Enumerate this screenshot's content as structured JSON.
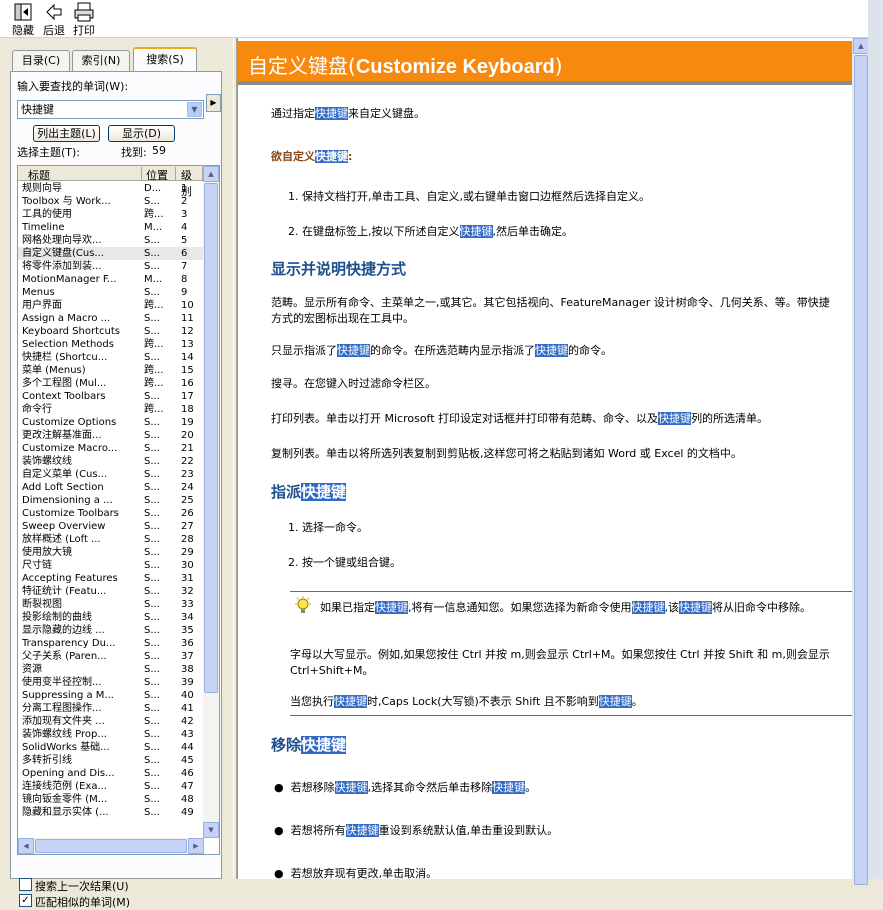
{
  "toolbar": {
    "hide": "隐藏",
    "back": "后退",
    "print": "打印"
  },
  "tabs": {
    "contents": "目录(C)",
    "index": "索引(N)",
    "search": "搜索(S)"
  },
  "search": {
    "prompt": "输入要查找的单词(W):",
    "value": "快捷键",
    "list_topics": "列出主题(L)",
    "display": "显示(D)",
    "select_topic": "选择主题(T):",
    "found_label": "找到:",
    "found_count": "59"
  },
  "columns": {
    "title": "标题",
    "location": "位置",
    "rank": "级别"
  },
  "results": [
    [
      "规则向导",
      "D...",
      "1"
    ],
    [
      "Toolbox 与 Work...",
      "S...",
      "2"
    ],
    [
      "工具的使用",
      "跨...",
      "3"
    ],
    [
      "Timeline",
      "M...",
      "4"
    ],
    [
      "网格处理向导欢...",
      "S...",
      "5"
    ],
    [
      "自定义键盘(Cus...",
      "S...",
      "6"
    ],
    [
      "将零件添加到装...",
      "S...",
      "7"
    ],
    [
      "MotionManager F...",
      "M...",
      "8"
    ],
    [
      "Menus",
      "S...",
      "9"
    ],
    [
      "用户界面",
      "跨...",
      "10"
    ],
    [
      "Assign a Macro ...",
      "S...",
      "11"
    ],
    [
      "Keyboard Shortcuts",
      "S...",
      "12"
    ],
    [
      "Selection Methods",
      "跨...",
      "13"
    ],
    [
      "快捷栏 (Shortcu...",
      "S...",
      "14"
    ],
    [
      "菜单 (Menus)",
      "跨...",
      "15"
    ],
    [
      "多个工程图 (Mul...",
      "跨...",
      "16"
    ],
    [
      "Context Toolbars",
      "S...",
      "17"
    ],
    [
      "命令行",
      "跨...",
      "18"
    ],
    [
      "Customize Options",
      "S...",
      "19"
    ],
    [
      "更改注解基准面...",
      "S...",
      "20"
    ],
    [
      "Customize Macro...",
      "S...",
      "21"
    ],
    [
      "装饰螺纹线",
      "S...",
      "22"
    ],
    [
      "自定义菜单 (Cus...",
      "S...",
      "23"
    ],
    [
      "Add Loft Section",
      "S...",
      "24"
    ],
    [
      "Dimensioning a ...",
      "S...",
      "25"
    ],
    [
      "Customize Toolbars",
      "S...",
      "26"
    ],
    [
      "Sweep Overview",
      "S...",
      "27"
    ],
    [
      "放样概述 (Loft ...",
      "S...",
      "28"
    ],
    [
      "使用放大镜",
      "S...",
      "29"
    ],
    [
      "尺寸链",
      "S...",
      "30"
    ],
    [
      "Accepting Features",
      "S...",
      "31"
    ],
    [
      "特征统计 (Featu...",
      "S...",
      "32"
    ],
    [
      "断裂视图",
      "S...",
      "33"
    ],
    [
      "投影绘制的曲线",
      "S...",
      "34"
    ],
    [
      "显示隐藏的边线 ...",
      "S...",
      "35"
    ],
    [
      "Transparency Du...",
      "S...",
      "36"
    ],
    [
      "父子关系 (Paren...",
      "S...",
      "37"
    ],
    [
      "资源",
      "S...",
      "38"
    ],
    [
      "使用变半径控制...",
      "S...",
      "39"
    ],
    [
      "Suppressing a M...",
      "S...",
      "40"
    ],
    [
      "分离工程图操作...",
      "S...",
      "41"
    ],
    [
      "添加现有文件夹 ...",
      "S...",
      "42"
    ],
    [
      "装饰螺纹线 Prop...",
      "S...",
      "43"
    ],
    [
      "SolidWorks 基础...",
      "S...",
      "44"
    ],
    [
      "多转折引线",
      "S...",
      "45"
    ],
    [
      "Opening and Dis...",
      "S...",
      "46"
    ],
    [
      "连接线范例 (Exa...",
      "S...",
      "47"
    ],
    [
      "镜向钣金零件 (M...",
      "S...",
      "48"
    ],
    [
      "隐藏和显示实体 (...",
      "S...",
      "49"
    ]
  ],
  "options": {
    "search_previous": "搜索上一次结果(U)",
    "match_similar": "匹配相似的单词(M)"
  },
  "page": {
    "title_cn": "自定义键盘(",
    "title_en": "Customize Keyboard",
    "title_end": ")",
    "intro_a": "通过指定",
    "kw": "快捷键",
    "intro_b": "来自定义键盘。",
    "want_a": "欲自定义",
    "want_b": ":",
    "step1": "1.  保持文档打开,单击工具、自定义,或右键单击窗口边框然后选择自定义。",
    "step2_a": "2.  在键盘标签上,按以下所述自定义",
    "step2_b": ",然后单击确定。",
    "h_display": "显示并说明快捷方式",
    "para_range": "范畴。显示所有命令、主菜单之一,或其它。其它包括视向、FeatureManager 设计树命令、几何关系、等。带快捷方式的宏图标出现在工具中。",
    "para_only_a": "只显示指派了",
    "para_only_b": "的命令。在所选范畴内显示指派了",
    "para_only_c": "的命令。",
    "para_search": "搜寻。在您键入时过滤命令栏区。",
    "para_print_a": "打印列表。单击以打开 Microsoft 打印设定对话框并打印带有范畴、命令、以及",
    "para_print_b": "列的所选清单。",
    "para_copy": "复制列表。单击以将所选列表复制到剪贴板,这样您可将之粘贴到诸如 Word 或 Excel 的文档中。",
    "h_assign": "指派",
    "assign1": "1.  选择一命令。",
    "assign2": "2.  按一个键或组合键。",
    "note1_a": "如果已指定",
    "note1_b": ",将有一信息通知您。如果您选择为新命令使用",
    "note1_c": ",该",
    "note1_d": "将从旧命令中移除。",
    "note2": "字母以大写显示。例如,如果您按住 Ctrl 并按 m,则会显示 Ctrl+M。如果您按住 Ctrl 并按 Shift 和 m,则会显示 Ctrl+Shift+M。",
    "note3_a": "当您执行",
    "note3_b": "时,Caps Lock(大写锁)不表示 Shift 且不影响到",
    "note3_c": "。",
    "h_remove": "移除",
    "rm1_a": "若想移除",
    "rm1_b": ",选择其命令然后单击移除",
    "rm1_c": "。",
    "rm2_a": "若想将所有",
    "rm2_b": "重设到系统默认值,单击重设到默认。",
    "rm3": "若想放弃现有更改,单击取消。"
  }
}
